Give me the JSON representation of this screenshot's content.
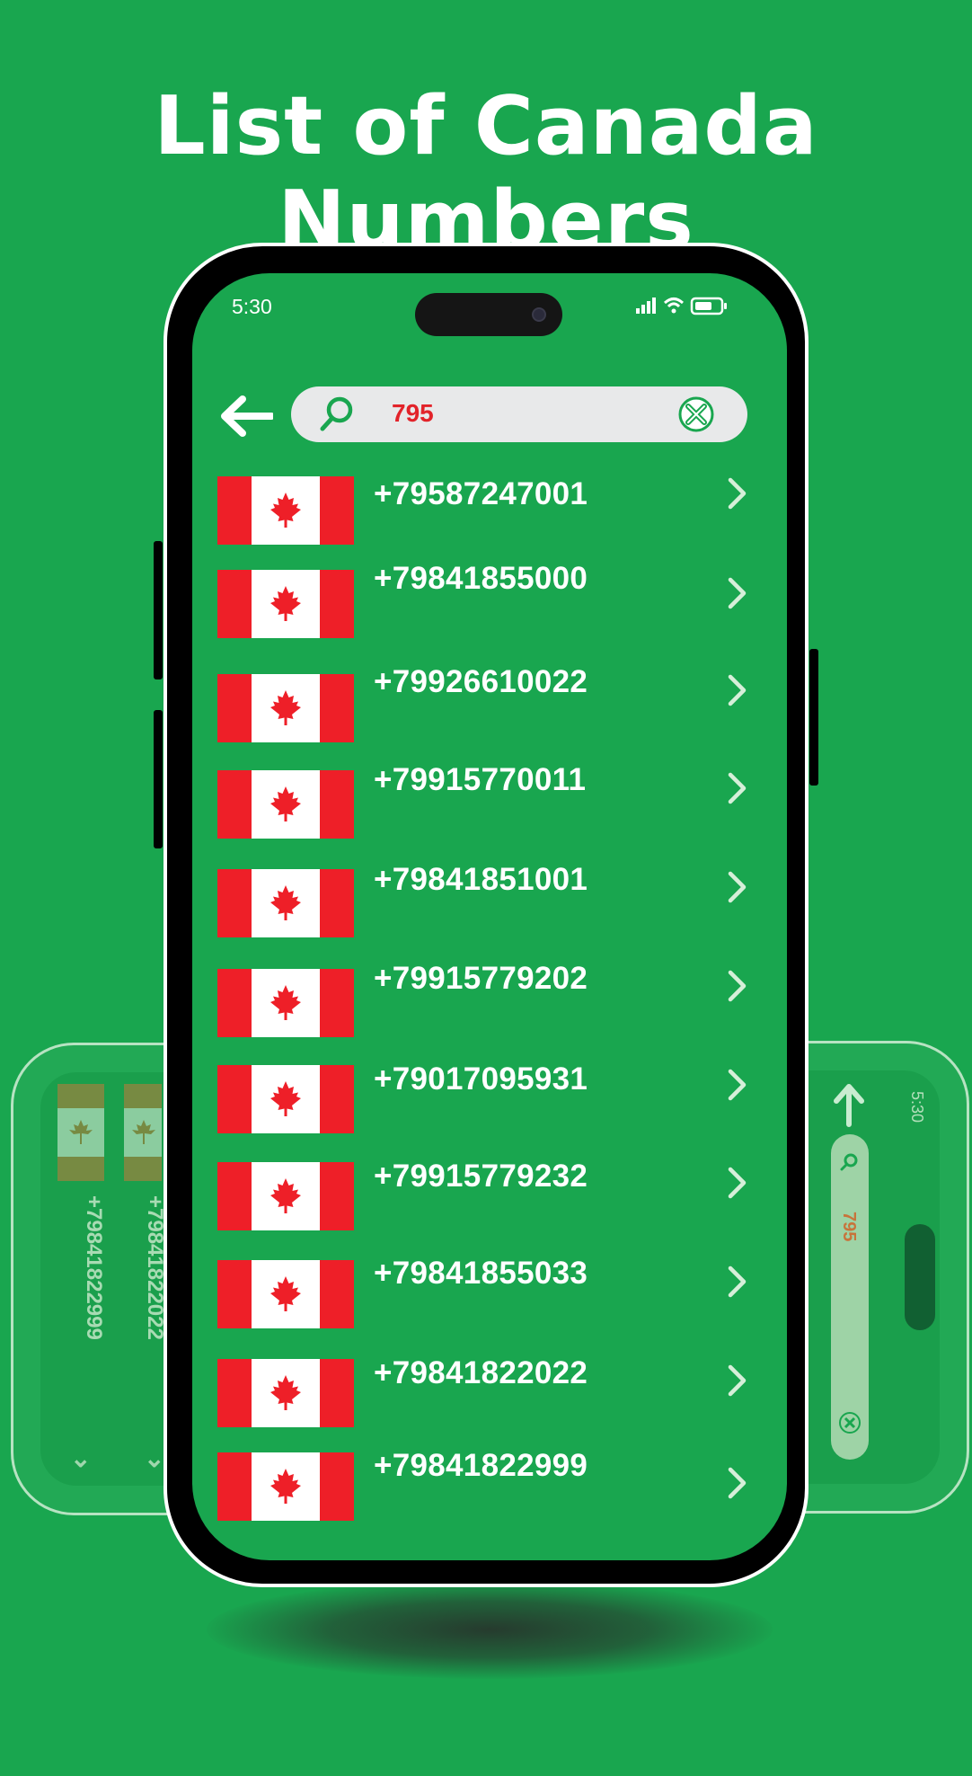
{
  "headline": "List of Canada Numbers",
  "status": {
    "time": "5:30"
  },
  "search": {
    "query": "795"
  },
  "numbers": [
    "+79587247001",
    "+79841855000",
    "+79926610022",
    "+79915770011",
    "+79841851001",
    "+79915779202",
    "+79017095931",
    "+79915779232",
    "+79841855033",
    "+79841822022",
    "+79841822999"
  ],
  "background_left": {
    "numbers": [
      "+79841822999",
      "+79841822022"
    ]
  },
  "background_right": {
    "time": "5:30",
    "query": "795"
  },
  "colors": {
    "background": "#19a64f",
    "flag_red": "#ee1f28",
    "search_bg": "#e8e9ea",
    "query_text": "#e2232a"
  },
  "icons": [
    "back-arrow-icon",
    "search-icon",
    "clear-icon",
    "chevron-right-icon",
    "maple-leaf-icon",
    "signal-icon",
    "wifi-icon",
    "battery-icon"
  ]
}
